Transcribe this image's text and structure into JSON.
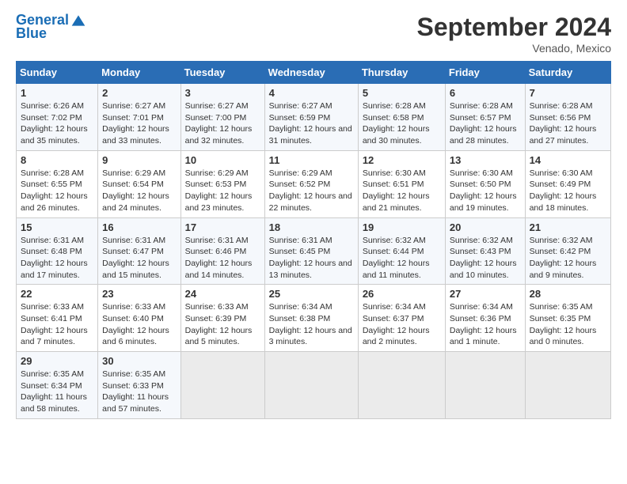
{
  "header": {
    "logo_line1": "General",
    "logo_line2": "Blue",
    "month": "September 2024",
    "location": "Venado, Mexico"
  },
  "columns": [
    "Sunday",
    "Monday",
    "Tuesday",
    "Wednesday",
    "Thursday",
    "Friday",
    "Saturday"
  ],
  "weeks": [
    [
      {
        "day": "1",
        "sunrise": "6:26 AM",
        "sunset": "7:02 PM",
        "daylight": "12 hours and 35 minutes."
      },
      {
        "day": "2",
        "sunrise": "6:27 AM",
        "sunset": "7:01 PM",
        "daylight": "12 hours and 33 minutes."
      },
      {
        "day": "3",
        "sunrise": "6:27 AM",
        "sunset": "7:00 PM",
        "daylight": "12 hours and 32 minutes."
      },
      {
        "day": "4",
        "sunrise": "6:27 AM",
        "sunset": "6:59 PM",
        "daylight": "12 hours and 31 minutes."
      },
      {
        "day": "5",
        "sunrise": "6:28 AM",
        "sunset": "6:58 PM",
        "daylight": "12 hours and 30 minutes."
      },
      {
        "day": "6",
        "sunrise": "6:28 AM",
        "sunset": "6:57 PM",
        "daylight": "12 hours and 28 minutes."
      },
      {
        "day": "7",
        "sunrise": "6:28 AM",
        "sunset": "6:56 PM",
        "daylight": "12 hours and 27 minutes."
      }
    ],
    [
      {
        "day": "8",
        "sunrise": "6:28 AM",
        "sunset": "6:55 PM",
        "daylight": "12 hours and 26 minutes."
      },
      {
        "day": "9",
        "sunrise": "6:29 AM",
        "sunset": "6:54 PM",
        "daylight": "12 hours and 24 minutes."
      },
      {
        "day": "10",
        "sunrise": "6:29 AM",
        "sunset": "6:53 PM",
        "daylight": "12 hours and 23 minutes."
      },
      {
        "day": "11",
        "sunrise": "6:29 AM",
        "sunset": "6:52 PM",
        "daylight": "12 hours and 22 minutes."
      },
      {
        "day": "12",
        "sunrise": "6:30 AM",
        "sunset": "6:51 PM",
        "daylight": "12 hours and 21 minutes."
      },
      {
        "day": "13",
        "sunrise": "6:30 AM",
        "sunset": "6:50 PM",
        "daylight": "12 hours and 19 minutes."
      },
      {
        "day": "14",
        "sunrise": "6:30 AM",
        "sunset": "6:49 PM",
        "daylight": "12 hours and 18 minutes."
      }
    ],
    [
      {
        "day": "15",
        "sunrise": "6:31 AM",
        "sunset": "6:48 PM",
        "daylight": "12 hours and 17 minutes."
      },
      {
        "day": "16",
        "sunrise": "6:31 AM",
        "sunset": "6:47 PM",
        "daylight": "12 hours and 15 minutes."
      },
      {
        "day": "17",
        "sunrise": "6:31 AM",
        "sunset": "6:46 PM",
        "daylight": "12 hours and 14 minutes."
      },
      {
        "day": "18",
        "sunrise": "6:31 AM",
        "sunset": "6:45 PM",
        "daylight": "12 hours and 13 minutes."
      },
      {
        "day": "19",
        "sunrise": "6:32 AM",
        "sunset": "6:44 PM",
        "daylight": "12 hours and 11 minutes."
      },
      {
        "day": "20",
        "sunrise": "6:32 AM",
        "sunset": "6:43 PM",
        "daylight": "12 hours and 10 minutes."
      },
      {
        "day": "21",
        "sunrise": "6:32 AM",
        "sunset": "6:42 PM",
        "daylight": "12 hours and 9 minutes."
      }
    ],
    [
      {
        "day": "22",
        "sunrise": "6:33 AM",
        "sunset": "6:41 PM",
        "daylight": "12 hours and 7 minutes."
      },
      {
        "day": "23",
        "sunrise": "6:33 AM",
        "sunset": "6:40 PM",
        "daylight": "12 hours and 6 minutes."
      },
      {
        "day": "24",
        "sunrise": "6:33 AM",
        "sunset": "6:39 PM",
        "daylight": "12 hours and 5 minutes."
      },
      {
        "day": "25",
        "sunrise": "6:34 AM",
        "sunset": "6:38 PM",
        "daylight": "12 hours and 3 minutes."
      },
      {
        "day": "26",
        "sunrise": "6:34 AM",
        "sunset": "6:37 PM",
        "daylight": "12 hours and 2 minutes."
      },
      {
        "day": "27",
        "sunrise": "6:34 AM",
        "sunset": "6:36 PM",
        "daylight": "12 hours and 1 minute."
      },
      {
        "day": "28",
        "sunrise": "6:35 AM",
        "sunset": "6:35 PM",
        "daylight": "12 hours and 0 minutes."
      }
    ],
    [
      {
        "day": "29",
        "sunrise": "6:35 AM",
        "sunset": "6:34 PM",
        "daylight": "11 hours and 58 minutes."
      },
      {
        "day": "30",
        "sunrise": "6:35 AM",
        "sunset": "6:33 PM",
        "daylight": "11 hours and 57 minutes."
      },
      null,
      null,
      null,
      null,
      null
    ]
  ]
}
